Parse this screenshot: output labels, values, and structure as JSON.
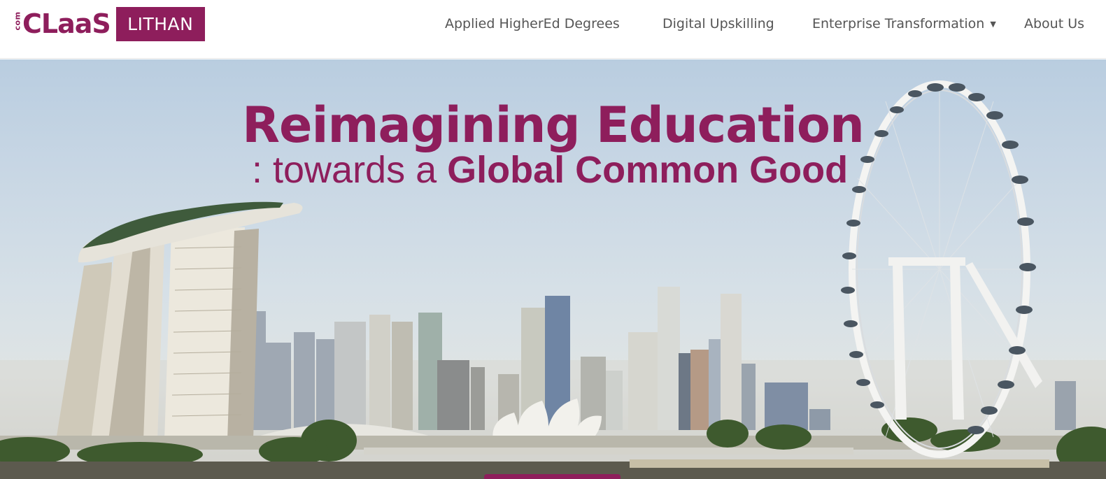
{
  "logo": {
    "com": "com",
    "claas": "CLaaS",
    "lithan": "LITHAN"
  },
  "nav": {
    "items": [
      {
        "label": "Applied HigherEd Degrees"
      },
      {
        "label": "Digital Upskilling"
      },
      {
        "label": "Enterprise Transformation",
        "dropdown_icon": "caret-down-icon"
      },
      {
        "label": "About Us"
      }
    ]
  },
  "hero": {
    "headline": "Reimagining Education",
    "subline_prefix": ": towards a ",
    "subline_bold": "Global Common Good"
  },
  "colors": {
    "brand": "#8e1e5c",
    "nav_text": "#555555"
  }
}
